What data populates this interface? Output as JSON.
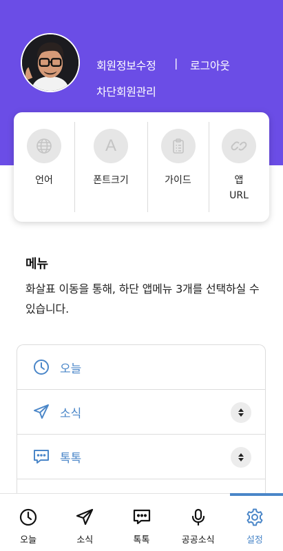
{
  "header": {
    "edit_profile": "회원정보수정",
    "separator": "|",
    "logout": "로그아웃",
    "blocked_members": "차단회원관리",
    "bg_color": "#6b4de6"
  },
  "quick": [
    {
      "label": "언어",
      "icon": "globe-icon"
    },
    {
      "label": "폰트크기",
      "icon": "font-letter-icon",
      "letter": "A"
    },
    {
      "label": "가이드",
      "icon": "clipboard-icon"
    },
    {
      "label": "앱\nURL",
      "icon": "link-icon"
    }
  ],
  "menu": {
    "title": "메뉴",
    "description": "화살표 이동을 통해, 하단 앱메뉴 3개를 선택하실 수 있습니다.",
    "items": [
      {
        "label": "오늘",
        "icon": "clock-icon"
      },
      {
        "label": "소식",
        "icon": "paper-plane-icon"
      },
      {
        "label": "톡톡",
        "icon": "chat-bubble-icon"
      }
    ]
  },
  "nav": {
    "items": [
      {
        "label": "오늘",
        "icon": "clock-icon"
      },
      {
        "label": "소식",
        "icon": "paper-plane-icon"
      },
      {
        "label": "톡톡",
        "icon": "chat-bubble-icon"
      },
      {
        "label": "공공소식",
        "icon": "microphone-icon"
      },
      {
        "label": "설정",
        "icon": "gear-icon",
        "active": true
      }
    ],
    "accent_color": "#4a86c8"
  }
}
